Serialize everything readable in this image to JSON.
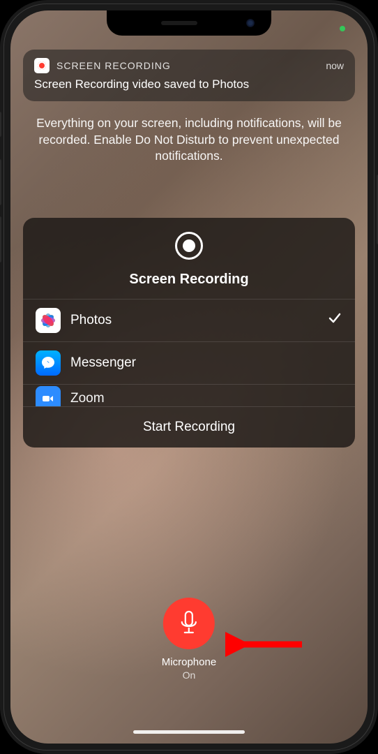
{
  "notification": {
    "app_name": "SCREEN RECORDING",
    "time_label": "now",
    "message": "Screen Recording video saved to Photos"
  },
  "description": "Everything on your screen, including notifications, will be recorded. Enable Do Not Disturb to prevent unexpected notifications.",
  "panel": {
    "title": "Screen Recording",
    "apps": {
      "photos": "Photos",
      "messenger": "Messenger",
      "zoom": "Zoom"
    },
    "start_label": "Start Recording"
  },
  "microphone": {
    "label": "Microphone",
    "state": "On"
  }
}
